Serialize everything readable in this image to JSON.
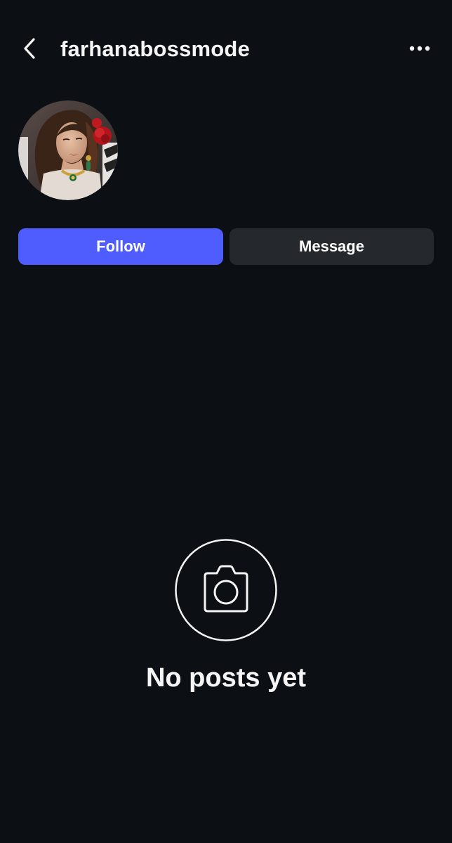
{
  "header": {
    "back_icon": "chevron-left-icon",
    "username": "farhanabossmode",
    "more_icon": "ellipsis-horizontal-icon"
  },
  "profile": {
    "avatar": "profile-photo"
  },
  "actions": {
    "follow_label": "Follow",
    "message_label": "Message"
  },
  "empty_state": {
    "icon": "camera-icon",
    "text": "No posts yet"
  },
  "colors": {
    "background": "#0c1014",
    "follow_button": "#4f5dff",
    "message_button": "#25292e",
    "text": "#f5f5f5"
  }
}
